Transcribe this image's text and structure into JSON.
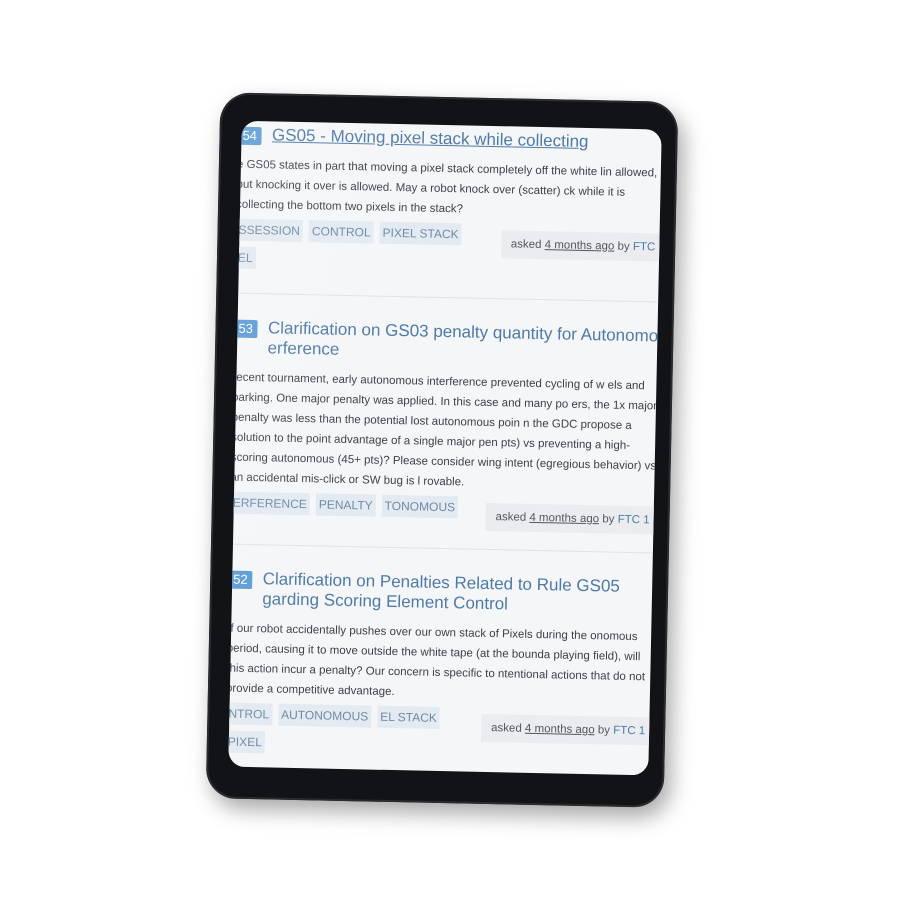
{
  "questions": [
    {
      "number": "54",
      "title": "GS05 - Moving pixel stack while collecting",
      "body": "e GS05 states in part that moving a pixel stack completely off the white lin allowed, but knocking it over is allowed. May a robot knock over (scatter) ck while it is collecting the bottom two pixels in the stack?",
      "tags": [
        "SSESSION",
        "CONTROL",
        "PIXEL STACK",
        "EL"
      ],
      "asked_prefix": "asked",
      "asked_time": "4 months ago",
      "asked_by": "by",
      "user": "FTC"
    },
    {
      "number": "53",
      "title": "Clarification on GS03 penalty quantity for Autonomo erference",
      "body": "recent tournament, early autonomous interference prevented cycling of w els and parking. One major penalty was applied. In this case and many po ers, the 1x major penalty was less than the potential lost autonomous poin n the GDC propose a solution to the point advantage of a single major pen pts) vs preventing a high-scoring autonomous (45+ pts)? Please consider wing intent (egregious behavior) vs an accidental mis-click or SW bug is l rovable.",
      "tags": [
        "ERFERENCE",
        "PENALTY",
        "TONOMOUS"
      ],
      "asked_prefix": "asked",
      "asked_time": "4 months ago",
      "asked_by": "by",
      "user": "FTC 1"
    },
    {
      "number": "52",
      "title": "Clarification on Penalties Related to Rule GS05 garding Scoring Element Control",
      "body": "If our robot accidentally pushes over our own stack of Pixels during the onomous period, causing it to move outside the white tape (at the bounda playing field), will this action incur a penalty? Our concern is specific to ntentional actions that do not provide a competitive advantage.",
      "tags": [
        "NTROL",
        "AUTONOMOUS",
        "EL STACK",
        "PIXEL"
      ],
      "asked_prefix": "asked",
      "asked_time": "4 months ago",
      "asked_by": "by",
      "user": "FTC 1"
    }
  ]
}
